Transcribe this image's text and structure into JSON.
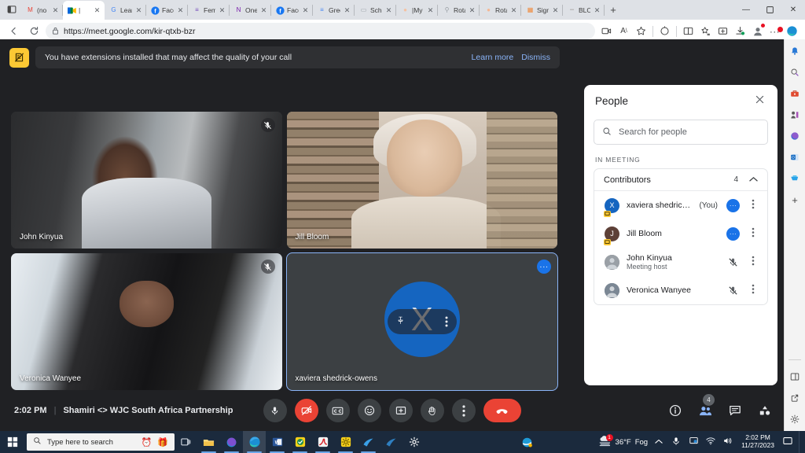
{
  "browser": {
    "url": "https://meet.google.com/kir-qtxb-bzr",
    "lock_icon": "lock-icon",
    "back_icon": "back-arrow-icon",
    "reload_icon": "reload-icon",
    "tab_list_icon": "tab-list-icon",
    "new_tab_icon": "+",
    "window_minimize": "—",
    "window_maximize": "⬜",
    "window_close": "✕",
    "tabs": [
      {
        "label": "(no s",
        "favicon": "gmail-icon",
        "active": false
      },
      {
        "label": "|",
        "favicon": "meet-icon",
        "active": true
      },
      {
        "label": "Learn",
        "favicon": "google-icon",
        "active": false
      },
      {
        "label": "Facel",
        "favicon": "facebook-icon",
        "active": false
      },
      {
        "label": "Fema",
        "favicon": "form-icon",
        "active": false
      },
      {
        "label": "One",
        "favicon": "onenote-icon",
        "active": false
      },
      {
        "label": "Facel",
        "favicon": "facebook-icon",
        "active": false
      },
      {
        "label": "Gree",
        "favicon": "docs-icon",
        "active": false
      },
      {
        "label": "Scho",
        "favicon": "page-icon",
        "active": false
      },
      {
        "label": "|My",
        "favicon": "circle-icon",
        "active": false
      },
      {
        "label": "Rota",
        "favicon": "search-icon",
        "active": false
      },
      {
        "label": "Rota",
        "favicon": "rotary-icon",
        "active": false
      },
      {
        "label": "Sign",
        "favicon": "grid-icon",
        "active": false
      },
      {
        "label": "BLO(",
        "favicon": "blog-icon",
        "active": false
      }
    ],
    "address_icons": [
      "screencast-icon",
      "read-aloud-icon",
      "favorite-star-icon",
      "copilot-icon",
      "split-screen-icon",
      "favorites-icon",
      "collections-icon",
      "downloads-icon",
      "profile-icon",
      "more-icon",
      "edge-sidebar-icon"
    ],
    "sidebar_icons": [
      "notifications-bell-icon",
      "search-icon",
      "tools-icon",
      "games-icon",
      "browser-essentials-icon",
      "outlook-icon",
      "shopping-icon",
      "add-icon"
    ],
    "sidebar_bottom_icons": [
      "split-pane-icon",
      "open-new-window-icon",
      "settings-gear-icon"
    ]
  },
  "meet": {
    "notification": {
      "icon": "extension-blocked-icon",
      "text": "You have extensions installed that may affect the quality of your call",
      "learn_more": "Learn more",
      "dismiss": "Dismiss"
    },
    "tiles": [
      {
        "name": "John Kinyua",
        "muted": true,
        "selected": false,
        "self": false
      },
      {
        "name": "Jill Bloom",
        "muted": false,
        "selected": false,
        "self": false
      },
      {
        "name": "Veronica Wanyee",
        "muted": true,
        "selected": false,
        "self": false
      },
      {
        "name": "xaviera shedrick-owens",
        "muted": false,
        "selected": true,
        "self": true,
        "initial": "X"
      }
    ],
    "tile_hover": {
      "pin_icon": "pin-icon",
      "more_icon": "more-vertical-icon"
    },
    "bar": {
      "time": "2:02 PM",
      "separator": "|",
      "meeting_title": "Shamiri <> WJC South Africa Partnership",
      "controls": [
        {
          "name": "microphone-button",
          "icon": "mic-icon",
          "state": "on"
        },
        {
          "name": "camera-button",
          "icon": "camera-off-icon",
          "state": "off"
        },
        {
          "name": "captions-button",
          "icon": "cc-icon",
          "state": "on"
        },
        {
          "name": "emoji-button",
          "icon": "emoji-icon",
          "state": "on"
        },
        {
          "name": "present-button",
          "icon": "present-icon",
          "state": "on"
        },
        {
          "name": "raise-hand-button",
          "icon": "hand-icon",
          "state": "on"
        },
        {
          "name": "more-options-button",
          "icon": "more-vertical-icon",
          "state": "on"
        },
        {
          "name": "leave-call-button",
          "icon": "hangup-icon",
          "state": "leave"
        }
      ],
      "right_controls": [
        {
          "name": "meeting-details-button",
          "icon": "info-icon",
          "badge": ""
        },
        {
          "name": "people-button",
          "icon": "people-icon",
          "badge": "4",
          "active": true
        },
        {
          "name": "chat-button",
          "icon": "chat-icon",
          "badge": ""
        },
        {
          "name": "activities-button",
          "icon": "activities-icon",
          "badge": ""
        }
      ]
    }
  },
  "people_panel": {
    "title": "People",
    "close_icon": "close-icon",
    "search": {
      "icon": "search-icon",
      "placeholder": "Search for people",
      "value": ""
    },
    "section_label": "IN MEETING",
    "group": {
      "label": "Contributors",
      "count": "4",
      "chevron_icon": "chevron-up-icon"
    },
    "participants": [
      {
        "name": "xaviera shedrick-o...",
        "you": "(You)",
        "sub": "",
        "initial": "X",
        "avatar_color": "#1565c0",
        "has_presentation_badge": true,
        "action": "more-dots-blue",
        "muted": false,
        "kebab": "more-vertical-icon"
      },
      {
        "name": "Jill Bloom",
        "you": "",
        "sub": "",
        "initial": "J",
        "avatar_color": "#5d4037",
        "has_presentation_badge": true,
        "action": "more-dots-blue",
        "muted": false,
        "kebab": "more-vertical-icon"
      },
      {
        "name": "John Kinyua",
        "you": "",
        "sub": "Meeting host",
        "initial": "",
        "avatar_color": "#9aa0a6",
        "has_presentation_badge": false,
        "action": "mic-off",
        "muted": true,
        "kebab": "more-vertical-icon"
      },
      {
        "name": "Veronica Wanyee",
        "you": "",
        "sub": "",
        "initial": "",
        "avatar_color": "#7b8794",
        "has_presentation_badge": false,
        "action": "mic-off",
        "muted": true,
        "kebab": "more-vertical-icon"
      }
    ]
  },
  "taskbar": {
    "start_icon": "windows-start-icon",
    "search_placeholder": "Type here to search",
    "search_icon": "search-icon",
    "search_extra_icons": [
      "alarm-clock-icon",
      "gift-icon"
    ],
    "pinned": [
      "task-view-icon",
      "file-explorer-icon",
      "app-teal-icon",
      "edge-icon",
      "word-icon",
      "kaspersky-icon",
      "acrobat-icon",
      "settings-yellow-icon",
      "mail-blue-icon",
      "teams-icon",
      "settings-gear-icon"
    ],
    "tray_app_icon": "ie-icon",
    "weather": {
      "icon": "fog-weather-icon",
      "badge": "1",
      "temp": "36°F",
      "condition": "Fog"
    },
    "tray_icons": [
      "chevron-up-icon",
      "mic-icon",
      "screen-icon",
      "network-icon",
      "volume-icon"
    ],
    "clock": {
      "time": "2:02 PM",
      "date": "11/27/2023"
    },
    "show_desktop": "show-desktop-button"
  }
}
